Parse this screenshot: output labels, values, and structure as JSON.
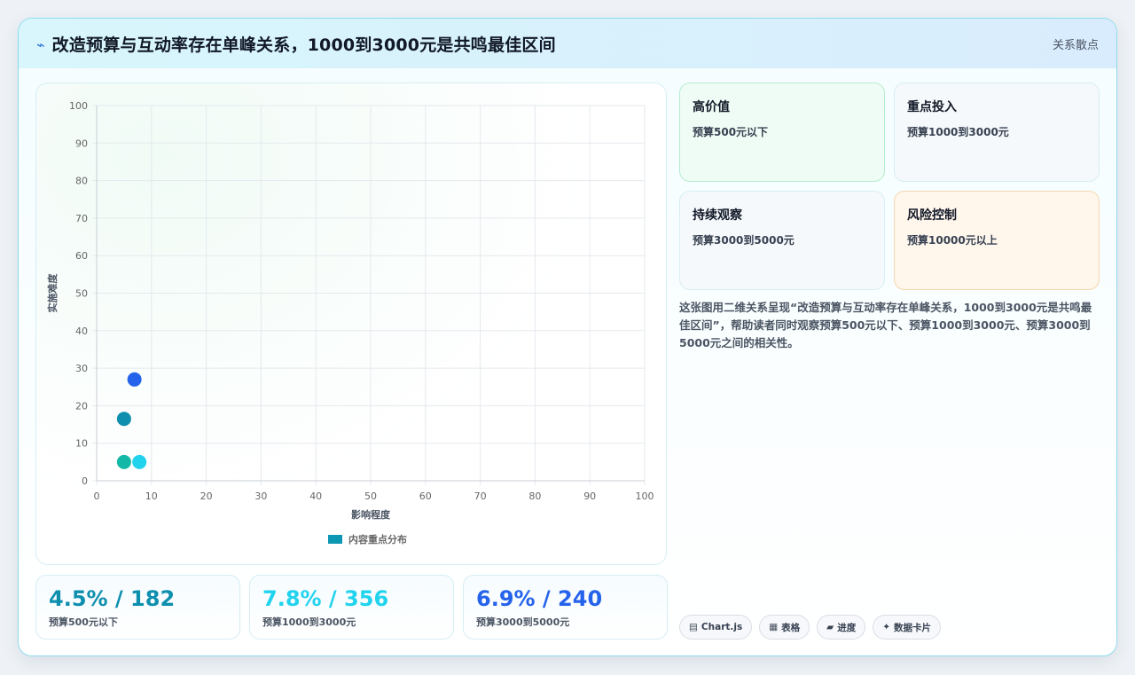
{
  "header": {
    "title": "改造预算与互动率存在单峰关系，1000到3000元是共鸣最佳区间",
    "tag": "关系散点"
  },
  "chart_data": {
    "type": "scatter",
    "xlabel": "影响程度",
    "ylabel": "实施难度",
    "xlim": [
      0,
      100
    ],
    "ylim": [
      0,
      100
    ],
    "x_ticks": [
      "0",
      "10",
      "20",
      "30",
      "40",
      "50",
      "60",
      "70",
      "80",
      "90",
      "100"
    ],
    "y_ticks": [
      "0",
      "10",
      "20",
      "30",
      "40",
      "50",
      "60",
      "70",
      "80",
      "90",
      "100"
    ],
    "grid": true,
    "legend_position": "bottom",
    "series": [
      {
        "name": "内容重点分布",
        "color": "#0e97b3",
        "points": [
          {
            "x": 6.9,
            "y": 27,
            "color": "#2563eb"
          },
          {
            "x": 5.0,
            "y": 16.5,
            "color": "#0e8fae"
          },
          {
            "x": 5.0,
            "y": 5,
            "color": "#14b8a6"
          },
          {
            "x": 7.8,
            "y": 5,
            "color": "#22d3ee"
          }
        ]
      }
    ]
  },
  "stats": [
    {
      "value": "4.5% / 182",
      "label": "预算500元以下",
      "color": "#0e8fae"
    },
    {
      "value": "7.8% / 356",
      "label": "预算1000到3000元",
      "color": "#22d3ee"
    },
    {
      "value": "6.9% / 240",
      "label": "预算3000到5000元",
      "color": "#2563eb"
    }
  ],
  "quadrants": [
    {
      "title": "高价值",
      "sub": "预算500元以下"
    },
    {
      "title": "重点投入",
      "sub": "预算1000到3000元"
    },
    {
      "title": "持续观察",
      "sub": "预算3000到5000元"
    },
    {
      "title": "风险控制",
      "sub": "预算10000元以上"
    }
  ],
  "description": "这张图用二维关系呈现“改造预算与互动率存在单峰关系，1000到3000元是共鸣最佳区间”，帮助读者同时观察预算500元以下、预算1000到3000元、预算3000到5000元之间的相关性。",
  "chips": [
    {
      "icon": "▤",
      "label": "Chart.js"
    },
    {
      "icon": "▦",
      "label": "表格"
    },
    {
      "icon": "▰",
      "label": "进度"
    },
    {
      "icon": "✦",
      "label": "数据卡片"
    }
  ]
}
